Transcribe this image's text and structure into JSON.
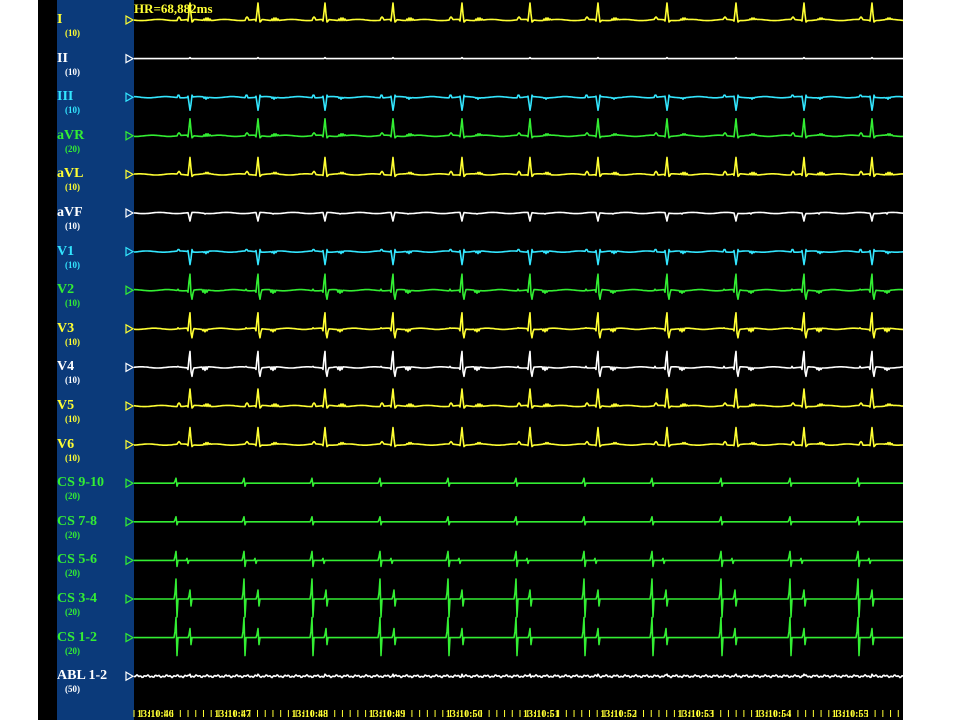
{
  "header": {
    "hr_readout": "HR=68,882ms"
  },
  "colors": {
    "yellow": "#ffff33",
    "white": "#ffffff",
    "cyan": "#33e6ff",
    "green": "#33ee33",
    "panel": "#0b3a7a"
  },
  "channels": [
    {
      "name": "I",
      "gain": "(10)",
      "color": "yellow",
      "kind": "ecg_pos"
    },
    {
      "name": "II",
      "gain": "(10)",
      "color": "white",
      "kind": "flat"
    },
    {
      "name": "III",
      "gain": "(10)",
      "color": "cyan",
      "kind": "ecg_neg"
    },
    {
      "name": "aVR",
      "gain": "(20)",
      "color": "green",
      "kind": "ecg_pos"
    },
    {
      "name": "aVL",
      "gain": "(10)",
      "color": "yellow",
      "kind": "ecg_pos"
    },
    {
      "name": "aVF",
      "gain": "(10)",
      "color": "white",
      "kind": "ecg_neg_small"
    },
    {
      "name": "V1",
      "gain": "(10)",
      "color": "cyan",
      "kind": "ecg_neg"
    },
    {
      "name": "V2",
      "gain": "(10)",
      "color": "green",
      "kind": "ecg_mixed"
    },
    {
      "name": "V3",
      "gain": "(10)",
      "color": "yellow",
      "kind": "ecg_mixed"
    },
    {
      "name": "V4",
      "gain": "(10)",
      "color": "white",
      "kind": "ecg_mixed"
    },
    {
      "name": "V5",
      "gain": "(10)",
      "color": "yellow",
      "kind": "ecg_pos"
    },
    {
      "name": "V6",
      "gain": "(10)",
      "color": "yellow",
      "kind": "ecg_pos"
    },
    {
      "name": "CS 9-10",
      "gain": "(20)",
      "color": "green",
      "kind": "spike_small"
    },
    {
      "name": "CS 7-8",
      "gain": "(20)",
      "color": "green",
      "kind": "spike_small"
    },
    {
      "name": "CS 5-6",
      "gain": "(20)",
      "color": "green",
      "kind": "spike_med"
    },
    {
      "name": "CS 3-4",
      "gain": "(20)",
      "color": "green",
      "kind": "spike_large"
    },
    {
      "name": "CS 1-2",
      "gain": "(20)",
      "color": "green",
      "kind": "spike_large"
    },
    {
      "name": "ABL 1-2",
      "gain": "(50)",
      "color": "white",
      "kind": "noise"
    }
  ],
  "time_axis": [
    "13:10:46",
    "13:10:47",
    "13:10:48",
    "13:10:49",
    "13:10:50",
    "13:10:51",
    "13:10:52",
    "13:10:53",
    "13:10:54",
    "13:10:55",
    "13:"
  ]
}
